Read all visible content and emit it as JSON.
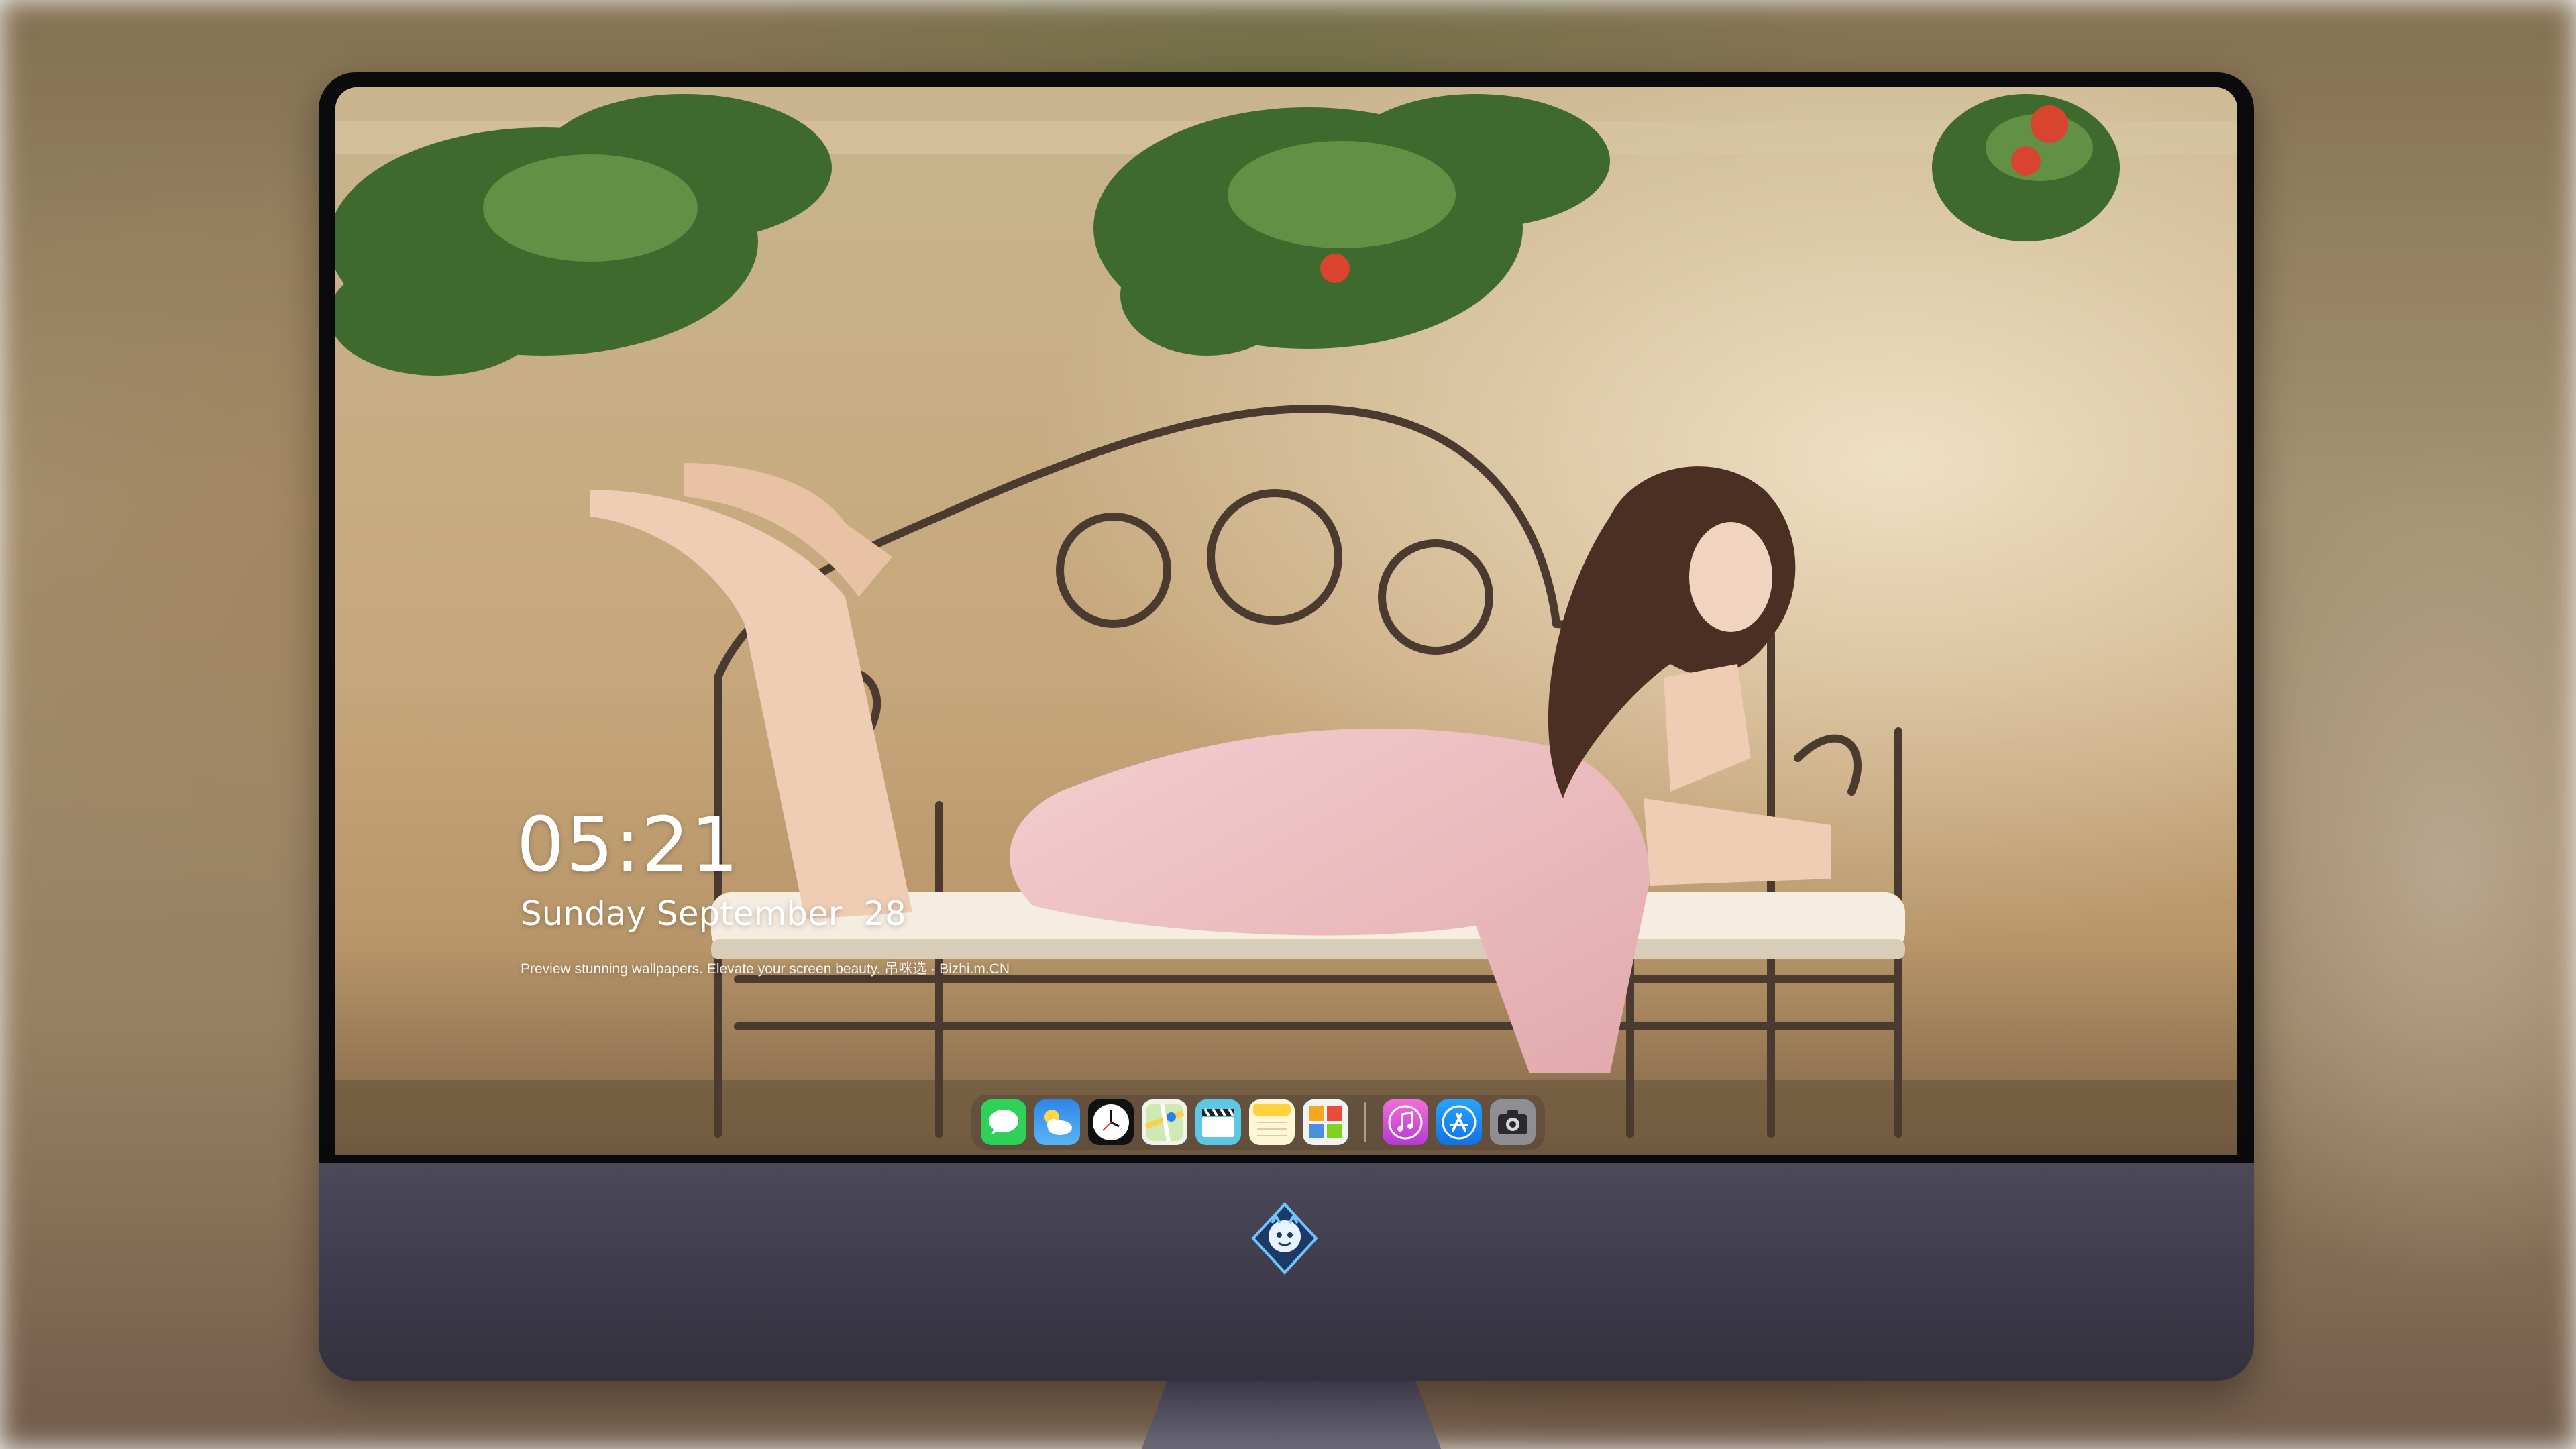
{
  "lockscreen": {
    "time": "05:21",
    "date": "Sunday September  28",
    "tagline": "Preview stunning wallpapers. Elevate your screen beauty. 吊咪选 · Bizhi.m.CN"
  },
  "dock": {
    "apps": [
      {
        "name": "Messages",
        "icon": "messages-icon",
        "color": "#2fd158"
      },
      {
        "name": "Weather",
        "icon": "weather-icon",
        "color": "#3d9cf0"
      },
      {
        "name": "Clock",
        "icon": "clock-icon",
        "color": "#111111"
      },
      {
        "name": "Maps",
        "icon": "maps-icon",
        "color": "#f2f2e8"
      },
      {
        "name": "Videos",
        "icon": "video-clapper-icon",
        "color": "#5cc8e6"
      },
      {
        "name": "Notes",
        "icon": "notes-icon",
        "color": "#ffd23f"
      },
      {
        "name": "Photos",
        "icon": "photos-icon",
        "color": "#f3f3f3"
      },
      {
        "name": "iTunes",
        "icon": "music-icon",
        "color": "#d64bd9"
      },
      {
        "name": "App Store",
        "icon": "app-store-icon",
        "color": "#1a8cff"
      },
      {
        "name": "Camera",
        "icon": "camera-icon",
        "color": "#8e8e93"
      }
    ]
  },
  "monitor": {
    "logo_icon": "dragon-mascot-icon"
  }
}
